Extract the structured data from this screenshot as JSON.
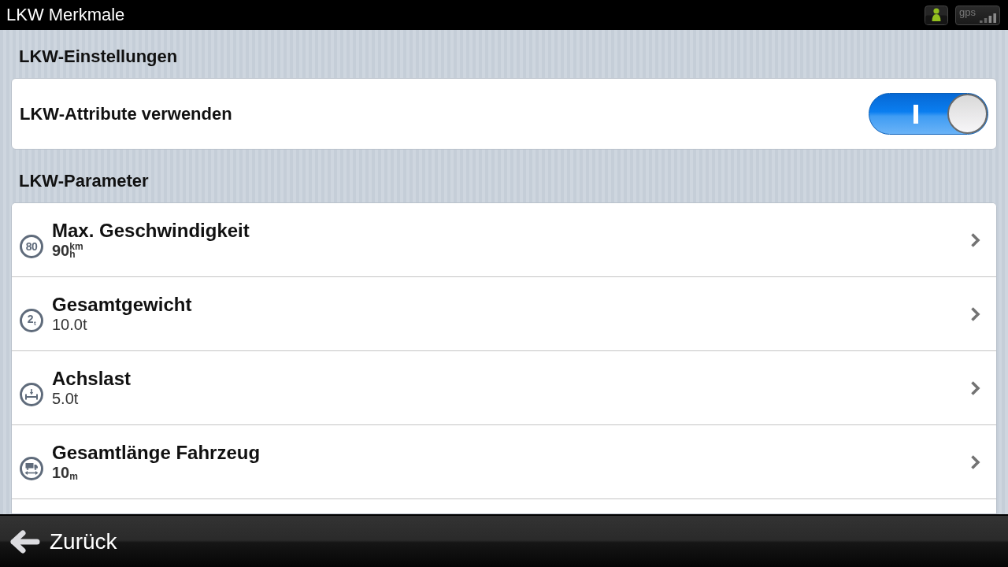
{
  "title_bar": {
    "title": "LKW Merkmale",
    "status": {
      "gps_label": "gps"
    }
  },
  "sections": [
    {
      "heading": "LKW-Einstellungen",
      "kind": "toggles",
      "items": [
        {
          "label": "LKW-Attribute verwenden",
          "on": true
        }
      ]
    },
    {
      "heading": "LKW-Parameter",
      "kind": "parameters",
      "items": [
        {
          "title": "Max. Geschwindigkeit",
          "value": "90$^{km}$$_{h}$",
          "value_bold": true,
          "kind": "speed",
          "sign_text": "80"
        },
        {
          "title": "Gesamtgewicht",
          "value": "10.0t",
          "value_bold": false,
          "kind": "weight",
          "sign_text": "2$_{t}$"
        },
        {
          "title": "Achslast",
          "value": "5.0t",
          "value_bold": false,
          "kind": "axle"
        },
        {
          "title": "Gesamtlänge Fahrzeug",
          "value": "10$_{m}$",
          "value_bold": true,
          "kind": "length"
        }
      ]
    }
  ],
  "footer": {
    "back_label": "Zurück"
  }
}
